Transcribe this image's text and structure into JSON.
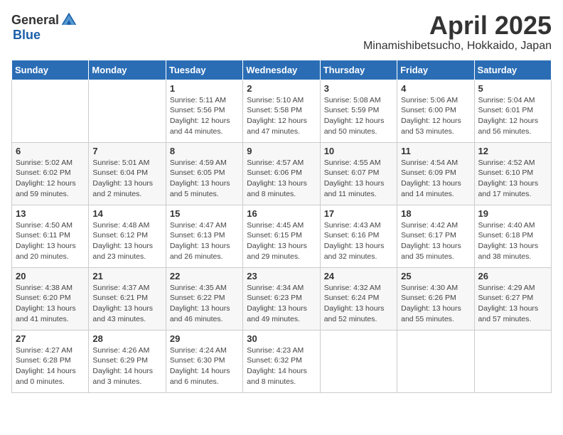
{
  "header": {
    "logo_general": "General",
    "logo_blue": "Blue",
    "month_title": "April 2025",
    "location": "Minamishibetsucho, Hokkaido, Japan"
  },
  "weekdays": [
    "Sunday",
    "Monday",
    "Tuesday",
    "Wednesday",
    "Thursday",
    "Friday",
    "Saturday"
  ],
  "weeks": [
    [
      {
        "day": "",
        "detail": ""
      },
      {
        "day": "",
        "detail": ""
      },
      {
        "day": "1",
        "detail": "Sunrise: 5:11 AM\nSunset: 5:56 PM\nDaylight: 12 hours\nand 44 minutes."
      },
      {
        "day": "2",
        "detail": "Sunrise: 5:10 AM\nSunset: 5:58 PM\nDaylight: 12 hours\nand 47 minutes."
      },
      {
        "day": "3",
        "detail": "Sunrise: 5:08 AM\nSunset: 5:59 PM\nDaylight: 12 hours\nand 50 minutes."
      },
      {
        "day": "4",
        "detail": "Sunrise: 5:06 AM\nSunset: 6:00 PM\nDaylight: 12 hours\nand 53 minutes."
      },
      {
        "day": "5",
        "detail": "Sunrise: 5:04 AM\nSunset: 6:01 PM\nDaylight: 12 hours\nand 56 minutes."
      }
    ],
    [
      {
        "day": "6",
        "detail": "Sunrise: 5:02 AM\nSunset: 6:02 PM\nDaylight: 12 hours\nand 59 minutes."
      },
      {
        "day": "7",
        "detail": "Sunrise: 5:01 AM\nSunset: 6:04 PM\nDaylight: 13 hours\nand 2 minutes."
      },
      {
        "day": "8",
        "detail": "Sunrise: 4:59 AM\nSunset: 6:05 PM\nDaylight: 13 hours\nand 5 minutes."
      },
      {
        "day": "9",
        "detail": "Sunrise: 4:57 AM\nSunset: 6:06 PM\nDaylight: 13 hours\nand 8 minutes."
      },
      {
        "day": "10",
        "detail": "Sunrise: 4:55 AM\nSunset: 6:07 PM\nDaylight: 13 hours\nand 11 minutes."
      },
      {
        "day": "11",
        "detail": "Sunrise: 4:54 AM\nSunset: 6:09 PM\nDaylight: 13 hours\nand 14 minutes."
      },
      {
        "day": "12",
        "detail": "Sunrise: 4:52 AM\nSunset: 6:10 PM\nDaylight: 13 hours\nand 17 minutes."
      }
    ],
    [
      {
        "day": "13",
        "detail": "Sunrise: 4:50 AM\nSunset: 6:11 PM\nDaylight: 13 hours\nand 20 minutes."
      },
      {
        "day": "14",
        "detail": "Sunrise: 4:48 AM\nSunset: 6:12 PM\nDaylight: 13 hours\nand 23 minutes."
      },
      {
        "day": "15",
        "detail": "Sunrise: 4:47 AM\nSunset: 6:13 PM\nDaylight: 13 hours\nand 26 minutes."
      },
      {
        "day": "16",
        "detail": "Sunrise: 4:45 AM\nSunset: 6:15 PM\nDaylight: 13 hours\nand 29 minutes."
      },
      {
        "day": "17",
        "detail": "Sunrise: 4:43 AM\nSunset: 6:16 PM\nDaylight: 13 hours\nand 32 minutes."
      },
      {
        "day": "18",
        "detail": "Sunrise: 4:42 AM\nSunset: 6:17 PM\nDaylight: 13 hours\nand 35 minutes."
      },
      {
        "day": "19",
        "detail": "Sunrise: 4:40 AM\nSunset: 6:18 PM\nDaylight: 13 hours\nand 38 minutes."
      }
    ],
    [
      {
        "day": "20",
        "detail": "Sunrise: 4:38 AM\nSunset: 6:20 PM\nDaylight: 13 hours\nand 41 minutes."
      },
      {
        "day": "21",
        "detail": "Sunrise: 4:37 AM\nSunset: 6:21 PM\nDaylight: 13 hours\nand 43 minutes."
      },
      {
        "day": "22",
        "detail": "Sunrise: 4:35 AM\nSunset: 6:22 PM\nDaylight: 13 hours\nand 46 minutes."
      },
      {
        "day": "23",
        "detail": "Sunrise: 4:34 AM\nSunset: 6:23 PM\nDaylight: 13 hours\nand 49 minutes."
      },
      {
        "day": "24",
        "detail": "Sunrise: 4:32 AM\nSunset: 6:24 PM\nDaylight: 13 hours\nand 52 minutes."
      },
      {
        "day": "25",
        "detail": "Sunrise: 4:30 AM\nSunset: 6:26 PM\nDaylight: 13 hours\nand 55 minutes."
      },
      {
        "day": "26",
        "detail": "Sunrise: 4:29 AM\nSunset: 6:27 PM\nDaylight: 13 hours\nand 57 minutes."
      }
    ],
    [
      {
        "day": "27",
        "detail": "Sunrise: 4:27 AM\nSunset: 6:28 PM\nDaylight: 14 hours\nand 0 minutes."
      },
      {
        "day": "28",
        "detail": "Sunrise: 4:26 AM\nSunset: 6:29 PM\nDaylight: 14 hours\nand 3 minutes."
      },
      {
        "day": "29",
        "detail": "Sunrise: 4:24 AM\nSunset: 6:30 PM\nDaylight: 14 hours\nand 6 minutes."
      },
      {
        "day": "30",
        "detail": "Sunrise: 4:23 AM\nSunset: 6:32 PM\nDaylight: 14 hours\nand 8 minutes."
      },
      {
        "day": "",
        "detail": ""
      },
      {
        "day": "",
        "detail": ""
      },
      {
        "day": "",
        "detail": ""
      }
    ]
  ]
}
